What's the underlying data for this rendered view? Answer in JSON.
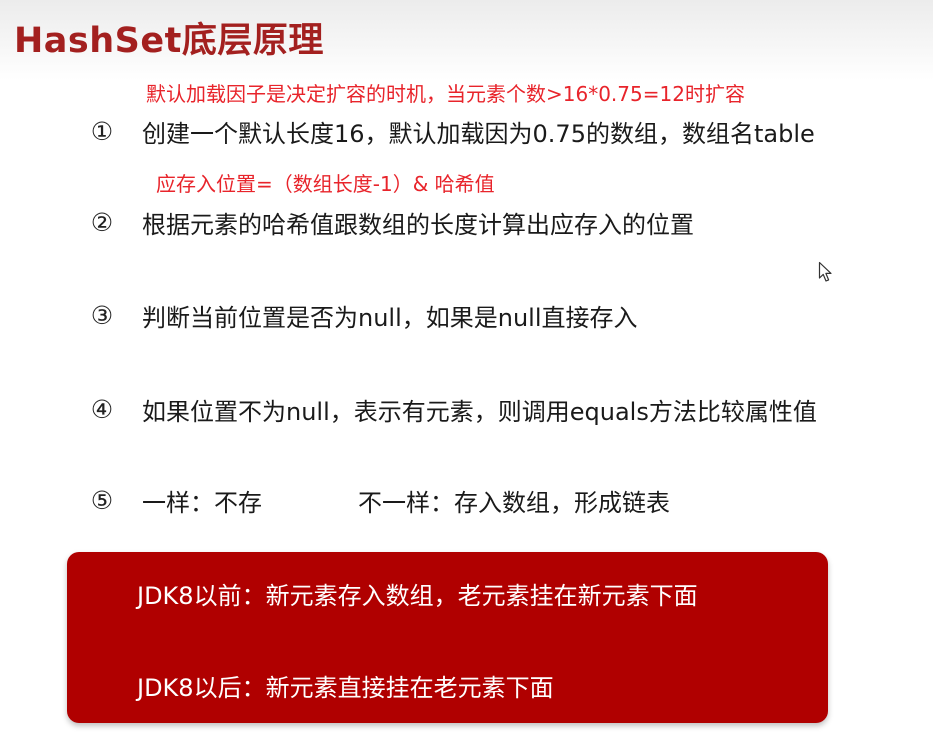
{
  "title": "HashSet底层原理",
  "notes": {
    "load_factor": "默认加载因子是决定扩容的时机，当元素个数>16*0.75=12时扩容",
    "index_formula": "应存入位置=（数组长度-1）& 哈希值"
  },
  "steps": [
    {
      "num": "①",
      "text": "创建一个默认长度16，默认加载因为0.75的数组，数组名table"
    },
    {
      "num": "②",
      "text": "根据元素的哈希值跟数组的长度计算出应存入的位置"
    },
    {
      "num": "③",
      "text": "判断当前位置是否为null，如果是null直接存入"
    },
    {
      "num": "④",
      "text": "如果位置不为null，表示有元素，则调用equals方法比较属性值"
    },
    {
      "num": "⑤",
      "text": "一样：不存",
      "text_b": "不一样：存入数组，形成链表"
    }
  ],
  "jdk_box": {
    "before": "JDK8以前：新元素存入数组，老元素挂在新元素下面",
    "after": "JDK8以后：新元素直接挂在老元素下面",
    "color": "#b00000"
  },
  "colors": {
    "title": "#a3201f",
    "note": "#e8242b"
  },
  "icons": {
    "cursor": "mouse-pointer-icon"
  }
}
